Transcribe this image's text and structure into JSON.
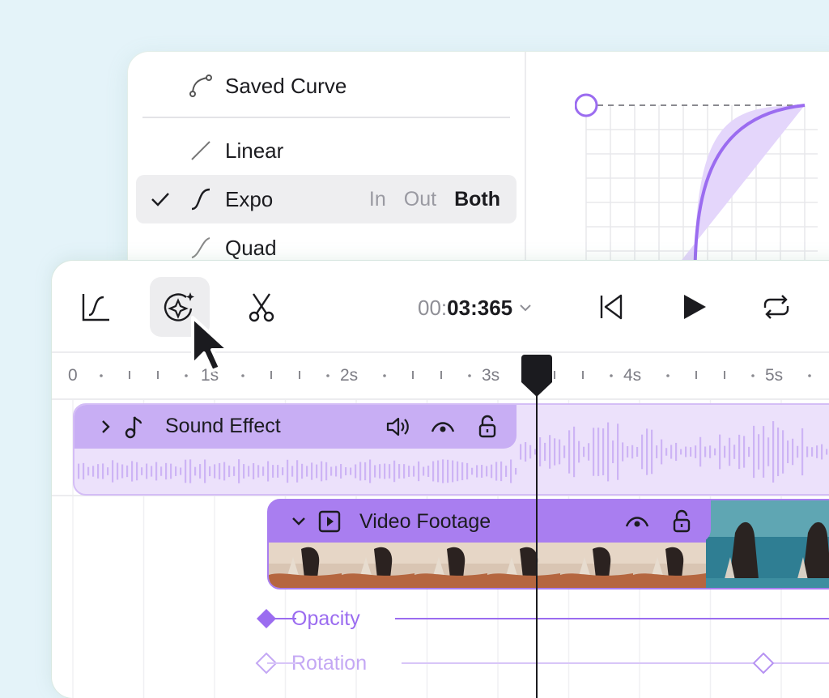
{
  "curve_menu": {
    "saved_curve": "Saved Curve",
    "items": [
      {
        "label": "Linear",
        "icon": "linear-curve-icon",
        "selected": false
      },
      {
        "label": "Expo",
        "icon": "expo-curve-icon",
        "selected": true
      },
      {
        "label": "Quad",
        "icon": "quad-curve-icon",
        "selected": false
      }
    ],
    "ease_options": [
      "In",
      "Out",
      "Both"
    ],
    "active_ease": "Both"
  },
  "toolbar": {
    "tools": [
      "curve-tool-icon",
      "magic-effects-icon",
      "scissors-icon"
    ],
    "timecode_prefix": "00:",
    "timecode_main": "03:365",
    "controls": [
      "skip-to-start-icon",
      "play-icon",
      "loop-icon"
    ]
  },
  "ruler": {
    "labels": [
      "0",
      "1s",
      "2s",
      "3s",
      "4s",
      "5s"
    ]
  },
  "tracks": {
    "audio": {
      "title": "Sound Effect",
      "icons": [
        "volume-icon",
        "visibility-icon",
        "unlock-icon"
      ]
    },
    "video": {
      "title": "Video Footage",
      "icons": [
        "visibility-icon",
        "unlock-icon"
      ]
    }
  },
  "parameters": [
    {
      "label": "Opacity",
      "keyframe": "filled"
    },
    {
      "label": "Rotation",
      "keyframe": "hollow"
    }
  ],
  "colors": {
    "accent": "#9b6cf0",
    "accent_light": "#ece1fb",
    "accent_mid": "#c8aef4",
    "background": "#e4f3f9"
  }
}
